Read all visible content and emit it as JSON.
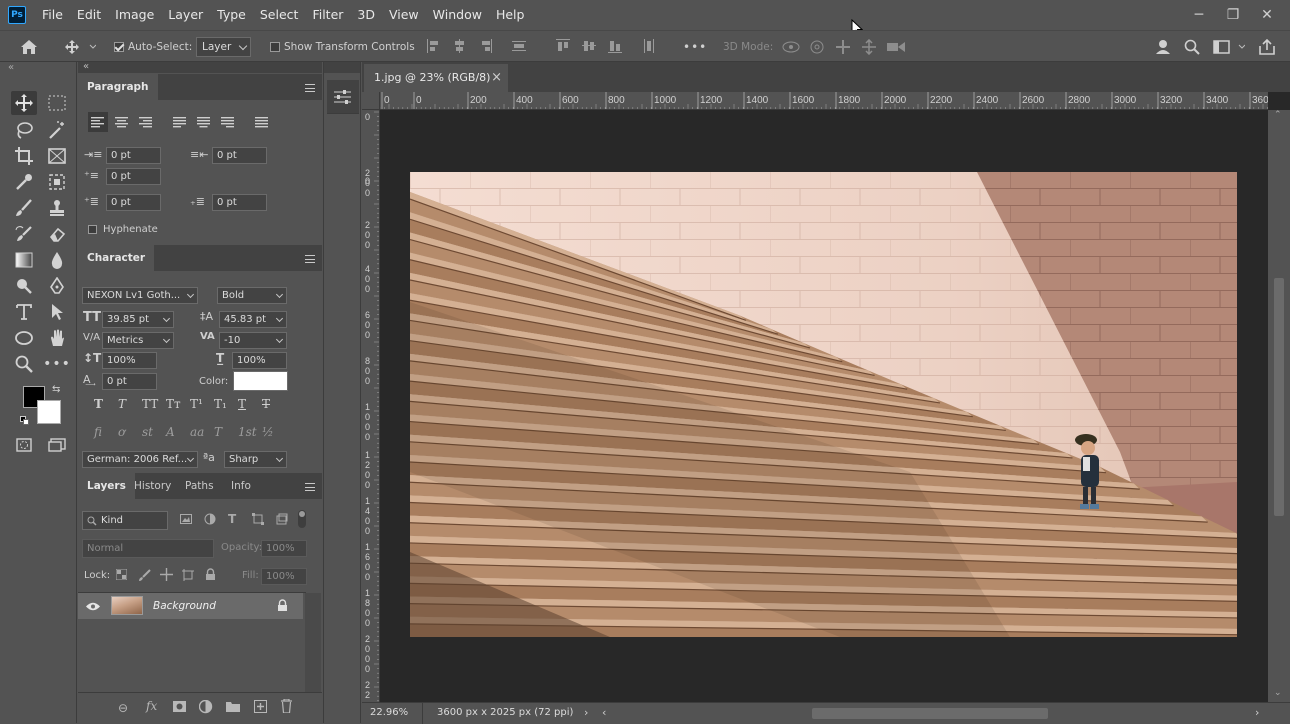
{
  "app": {
    "logo_text": "Ps"
  },
  "menu": [
    "File",
    "Edit",
    "Image",
    "Layer",
    "Type",
    "Select",
    "Filter",
    "3D",
    "View",
    "Window",
    "Help"
  ],
  "window_controls": {
    "minimize": "─",
    "restore": "❐",
    "close": "✕"
  },
  "options_bar": {
    "auto_select_label": "Auto-Select:",
    "auto_select_target": "Layer",
    "show_transform_label": "Show Transform Controls",
    "more": "•••",
    "mode_3d_label": "3D Mode:"
  },
  "paragraph": {
    "tab": "Paragraph",
    "indent_left": "0 pt",
    "indent_right": "0 pt",
    "indent_first": "0 pt",
    "space_before": "0 pt",
    "space_after": "0 pt",
    "hyphenate_label": "Hyphenate"
  },
  "character": {
    "tab": "Character",
    "font_family": "NEXON Lv1 Goth...",
    "font_style": "Bold",
    "font_size": "39.85 pt",
    "leading": "45.83 pt",
    "kerning": "Metrics",
    "tracking": "-10",
    "vertical_scale": "100%",
    "horizontal_scale": "100%",
    "baseline_shift": "0 pt",
    "color_label": "Color:",
    "color_value": "#ffffff",
    "type_styles": [
      "T",
      "T",
      "TT",
      "Tт",
      "T¹",
      "T₁",
      "T",
      "T"
    ],
    "opentype": [
      "fi",
      "ơ",
      "st",
      "A",
      "aa",
      "T",
      "1st",
      "½"
    ],
    "language": "German: 2006 Ref...",
    "aa_icon": "ªa",
    "antialias": "Sharp"
  },
  "layers": {
    "tabs": [
      "Layers",
      "History",
      "Paths",
      "Info"
    ],
    "filter_kind": "Kind",
    "blend_mode": "Normal",
    "opacity_label": "Opacity:",
    "opacity_value": "100%",
    "lock_label": "Lock:",
    "fill_label": "Fill:",
    "fill_value": "100%",
    "items": [
      {
        "name": "Background",
        "visible": true,
        "locked": true
      }
    ]
  },
  "document": {
    "tab_title": "1.jpg @ 23% (RGB/8)",
    "close": "×",
    "zoom": "22.96%",
    "dimensions": "3600 px x 2025 px (72 ppi)"
  },
  "ruler": {
    "h_labels": [
      "0",
      "0",
      "200",
      "400",
      "600",
      "800",
      "1000",
      "1200",
      "1400",
      "1600",
      "1800",
      "2000",
      "2200",
      "2400",
      "2600",
      "2800",
      "3000",
      "3200",
      "3400",
      "3600"
    ],
    "v_labels": [
      "0",
      "2 0 0",
      "0",
      "2 0 0",
      "4 0 0",
      "6 0 0",
      "8 0 0",
      "1 0 0 0",
      "1 2 0 0",
      "1 4 0 0",
      "1 6 0 0",
      "1 8 0 0",
      "2 0 0 0",
      "2 2"
    ]
  },
  "colors": {
    "foreground": "#000000",
    "background": "#ffffff",
    "accent": "#31a8ff"
  }
}
